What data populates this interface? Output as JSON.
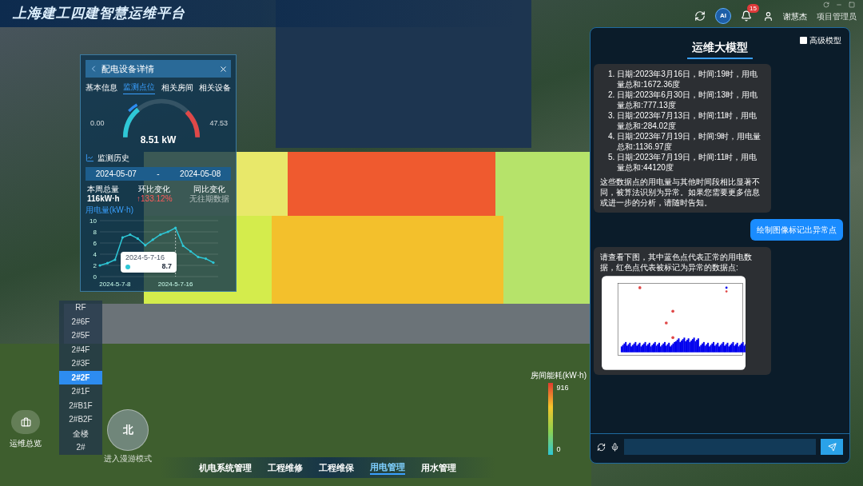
{
  "header": {
    "title": "上海建工四建智慧运维平台",
    "ai_badge": "AI",
    "notifications": "15",
    "user_name": "谢慧杰",
    "user_role": "项目管理员"
  },
  "device_panel": {
    "title": "配电设备详情",
    "tabs": [
      {
        "label": "基本信息",
        "selected": false
      },
      {
        "label": "监测点位",
        "selected": true
      },
      {
        "label": "相关房间",
        "selected": false
      },
      {
        "label": "相关设备",
        "selected": false
      }
    ],
    "gauge": {
      "min": "0.00",
      "max": "47.53",
      "reading": "8.51 kW",
      "level": 0.18
    },
    "history_title": "监测历史",
    "date_from": "2024-05-07",
    "date_sep": "-",
    "date_to": "2024-05-08",
    "stats": [
      {
        "label": "本周总量",
        "value": "116kW·h",
        "kind": "plain"
      },
      {
        "label": "环比变化",
        "value": "↑133.12%",
        "kind": "up"
      },
      {
        "label": "同比变化",
        "value": "无往期数据",
        "kind": "muted"
      }
    ],
    "chart_data": {
      "type": "line",
      "ylabel": "用电量(kW·h)",
      "categories": [
        null,
        null,
        "2024-5-7-8",
        null,
        null,
        null,
        null,
        null,
        null,
        null,
        "2024-5-7-16",
        null,
        null,
        null,
        null,
        null
      ],
      "series": [
        {
          "color": "#2ec7d6",
          "values": [
            2,
            2.4,
            3,
            7,
            7.5,
            6.8,
            5.6,
            6.6,
            7.5,
            8,
            8.7,
            5.5,
            4.5,
            3.5,
            3.2,
            2.5
          ]
        }
      ],
      "ylim": [
        0,
        10
      ],
      "yticks": [
        0,
        2,
        4,
        6,
        8,
        10
      ],
      "grid": true
    },
    "tooltip": {
      "title": "2024-5-7-16",
      "value": "8.7"
    }
  },
  "floors": [
    {
      "label": "RF",
      "selected": false
    },
    {
      "label": "2#6F",
      "selected": false
    },
    {
      "label": "2#5F",
      "selected": false
    },
    {
      "label": "2#4F",
      "selected": false
    },
    {
      "label": "2#3F",
      "selected": false
    },
    {
      "label": "2#2F",
      "selected": true
    },
    {
      "label": "2#1F",
      "selected": false
    },
    {
      "label": "2#B1F",
      "selected": false
    },
    {
      "label": "2#B2F",
      "selected": false
    },
    {
      "label": "全楼",
      "selected": false
    },
    {
      "label": "2#",
      "selected": false
    }
  ],
  "overview": {
    "label": "运维总览"
  },
  "compass": {
    "label": "北",
    "caption": "进入漫游模式"
  },
  "legend": {
    "title": "房间能耗(kW·h)",
    "max": "916",
    "min": "0"
  },
  "bottom_nav": [
    {
      "label": "机电系统管理",
      "selected": false
    },
    {
      "label": "工程维修",
      "selected": false
    },
    {
      "label": "工程维保",
      "selected": false
    },
    {
      "label": "用电管理",
      "selected": true
    },
    {
      "label": "用水管理",
      "selected": false
    }
  ],
  "assistant": {
    "title": "运维大模型",
    "advanced": {
      "label": "高级模型",
      "checked": false
    },
    "messages": [
      {
        "kind": "list",
        "items": [
          {
            "marker": "1.",
            "text": "日期:2023年3月16日，时间:19时，用电量总和:1672.36度"
          },
          {
            "marker": "2.",
            "text": "日期:2023年6月30日，时间:13时，用电量总和:777.13度"
          },
          {
            "marker": "3.",
            "text": "日期:2023年7月13日，时间:11时，用电量总和:284.02度"
          },
          {
            "marker": "4.",
            "text": "日期:2023年7月19日，时间:9时，用电量总和:1136.97度"
          },
          {
            "marker": "5.",
            "text": "日期:2023年7月19日，时间:11时，用电量总和:44120度"
          }
        ],
        "text": "这些数据点的用电量与其他时间段相比显著不同，被算法识别为异常。如果您需要更多信息或进一步的分析，请随时告知。"
      },
      {
        "kind": "request",
        "text": "绘制图像标记出异常点"
      },
      {
        "kind": "image",
        "text": "请查看下图，其中蓝色点代表正常的用电数据，红色点代表被标记为异常的数据点:"
      }
    ]
  }
}
